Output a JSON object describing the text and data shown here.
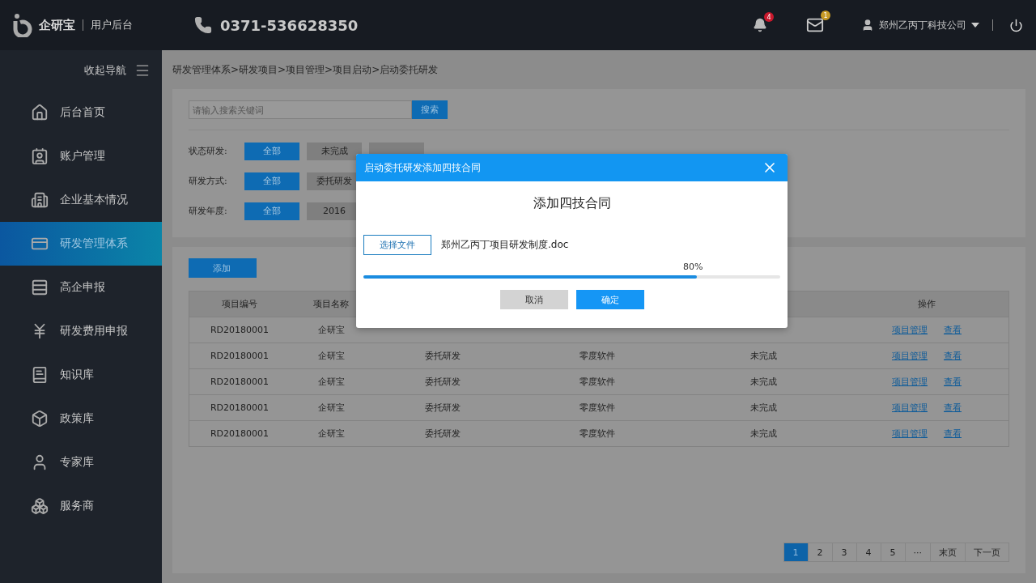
{
  "header": {
    "brand": "企研宝",
    "subtitle": "用户后台",
    "phone": "0371-536628350",
    "notifications": "4",
    "messages": "1",
    "user": "郑州乙丙丁科技公司"
  },
  "sidebar": {
    "collapse_label": "收起导航",
    "items": [
      {
        "label": "后台首页",
        "selected": false
      },
      {
        "label": "账户管理",
        "selected": false
      },
      {
        "label": "企业基本情况",
        "selected": false
      },
      {
        "label": "研发管理体系",
        "selected": true
      },
      {
        "label": "高企申报",
        "selected": false
      },
      {
        "label": "研发费用申报",
        "selected": false
      },
      {
        "label": "知识库",
        "selected": false
      },
      {
        "label": "政策库",
        "selected": false
      },
      {
        "label": "专家库",
        "selected": false
      },
      {
        "label": "服务商",
        "selected": false
      }
    ]
  },
  "breadcrumb": "研发管理体系>研发项目>项目管理>项目启动>启动委托研发",
  "search": {
    "placeholder": "请输入搜索关键词",
    "button": "搜索"
  },
  "filters": [
    {
      "label": "状态研发:",
      "options": [
        {
          "label": "全部",
          "selected": true
        },
        {
          "label": "未完成",
          "selected": false
        },
        {
          "selected": false
        }
      ]
    },
    {
      "label": "研发方式:",
      "options": [
        {
          "label": "全部",
          "selected": true
        },
        {
          "label": "委托研发",
          "selected": false
        }
      ]
    },
    {
      "label": "研发年度:",
      "options": [
        {
          "label": "全部",
          "selected": true
        },
        {
          "label": "2016",
          "selected": false
        }
      ]
    }
  ],
  "add_button": "添加",
  "table": {
    "columns": [
      {
        "label": "项目编号"
      },
      {
        "label": "项目名称"
      },
      {},
      {},
      {},
      {
        "label": "操作"
      }
    ],
    "rows": [
      {
        "cells": [
          "RD20180001",
          "企研宝"
        ],
        "actions": [
          "项目管理",
          "查看"
        ]
      },
      {
        "cells": [
          "RD20180001",
          "企研宝",
          "委托研发",
          "零度软件",
          "未完成"
        ],
        "actions": [
          "项目管理",
          "查看"
        ]
      },
      {
        "cells": [
          "RD20180001",
          "企研宝",
          "委托研发",
          "零度软件",
          "未完成"
        ],
        "actions": [
          "项目管理",
          "查看"
        ]
      },
      {
        "cells": [
          "RD20180001",
          "企研宝",
          "委托研发",
          "零度软件",
          "未完成"
        ],
        "actions": [
          "项目管理",
          "查看"
        ]
      },
      {
        "cells": [
          "RD20180001",
          "企研宝",
          "委托研发",
          "零度软件",
          "未完成"
        ],
        "actions": [
          "项目管理",
          "查看"
        ]
      }
    ]
  },
  "pagination": [
    {
      "label": "1",
      "selected": true
    },
    {
      "label": "2",
      "selected": false
    },
    {
      "label": "3",
      "selected": false
    },
    {
      "label": "4",
      "selected": false
    },
    {
      "label": "5",
      "selected": false
    },
    {
      "label": "···",
      "selected": false
    },
    {
      "label": "末页",
      "selected": false
    },
    {
      "label": "下一页",
      "selected": false
    }
  ],
  "dialog": {
    "title": "启动委托研发添加四技合同",
    "heading": "添加四技合同",
    "choose_button": "选择文件",
    "file_name": "郑州乙丙丁项目研发制度.doc",
    "progress_label": "80%",
    "level": 0.8,
    "buttons": [
      {
        "label": "取消",
        "kind": "cancel"
      },
      {
        "label": "确定",
        "kind": "confirm"
      }
    ]
  }
}
